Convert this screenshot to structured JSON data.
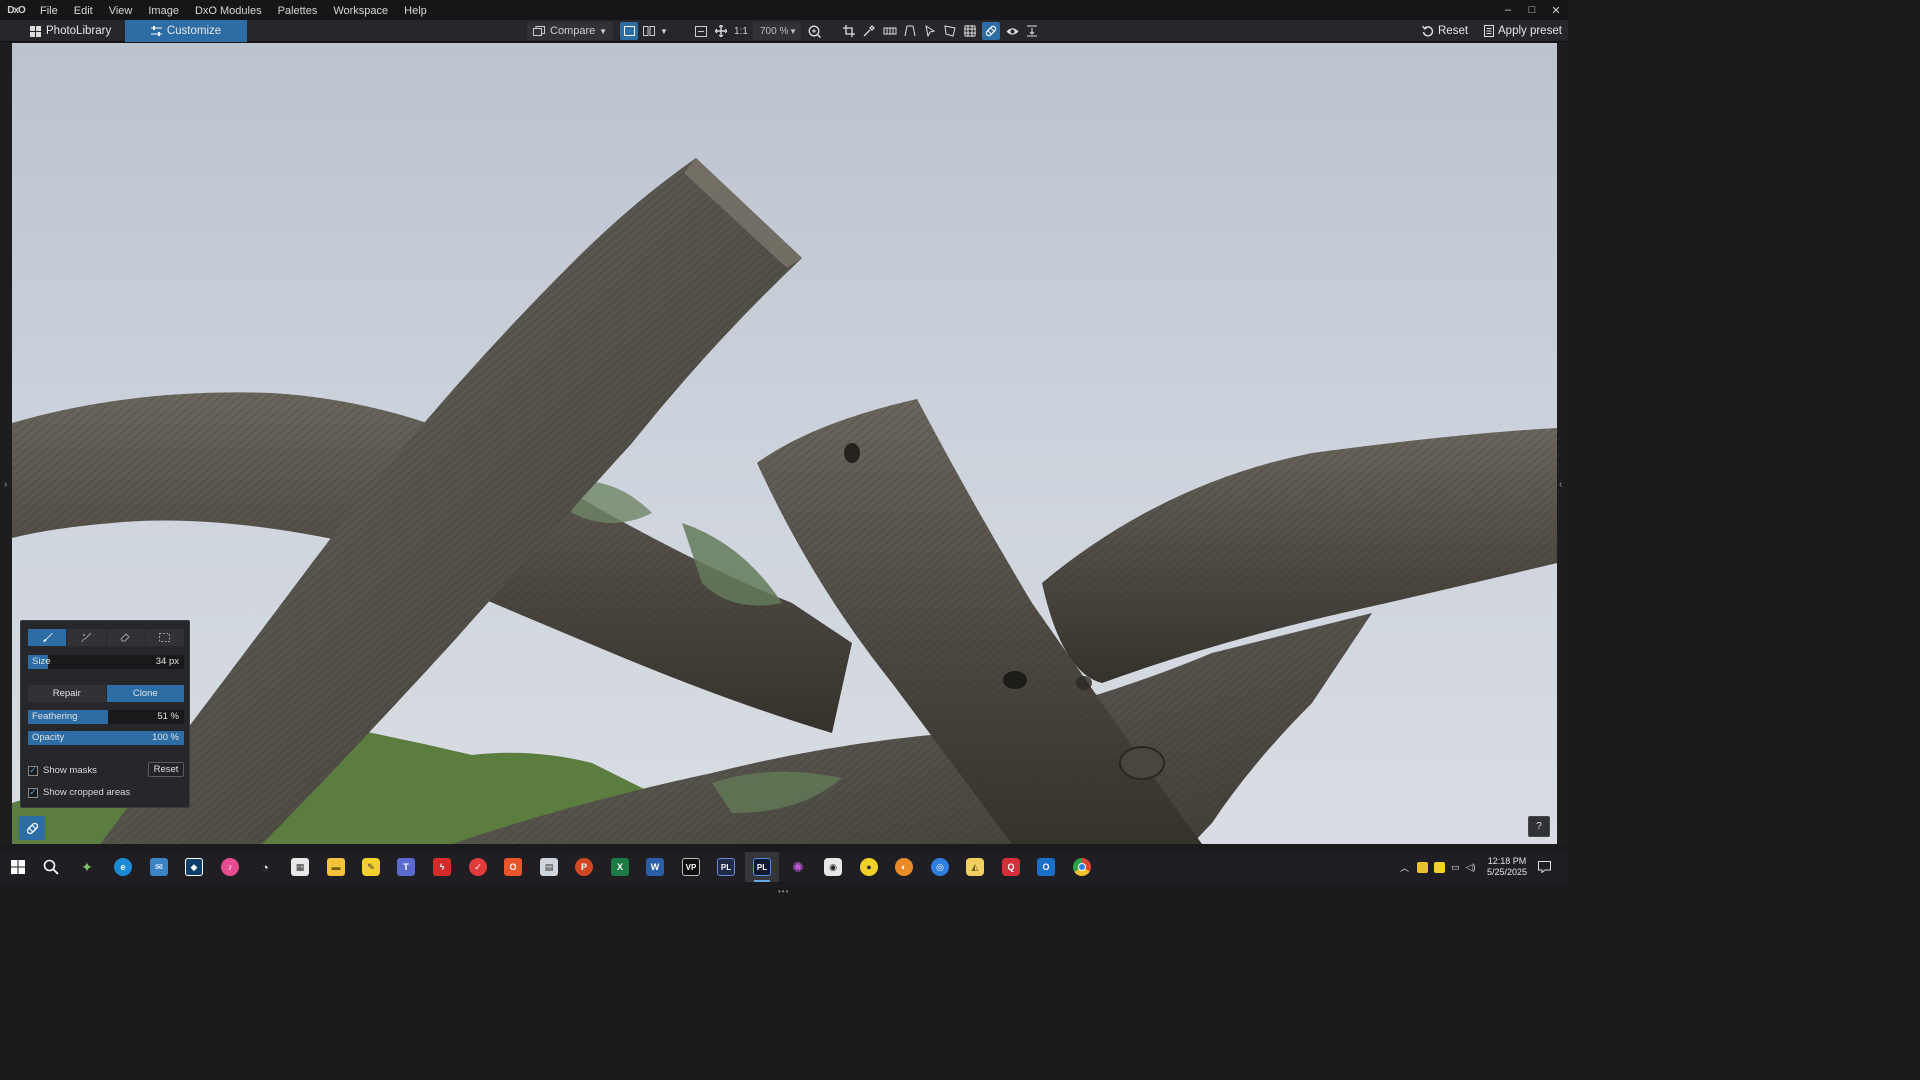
{
  "app": {
    "logo_text": "DxO"
  },
  "menu": [
    "File",
    "Edit",
    "View",
    "Image",
    "DxO Modules",
    "Palettes",
    "Workspace",
    "Help"
  ],
  "window_controls": {
    "minimize": "–",
    "maximize": "□",
    "close": "✕"
  },
  "tabs": {
    "library": "PhotoLibrary",
    "customize": "Customize",
    "active": "Customize"
  },
  "toolbar": {
    "compare_label": "Compare",
    "one_to_one": "1:1",
    "zoom_value": "700 %",
    "reset_label": "Reset",
    "apply_preset_label": "Apply preset",
    "active_tool": "repair-tool"
  },
  "repair_panel": {
    "modes": [
      "brush",
      "auto-brush",
      "eraser",
      "selection"
    ],
    "active_mode": "brush",
    "size": {
      "label": "Size",
      "value": "34 px",
      "fraction": 0.13
    },
    "repair_label": "Repair",
    "clone_label": "Clone",
    "active_type": "Clone",
    "feathering": {
      "label": "Feathering",
      "value": "51 %",
      "fraction": 0.51
    },
    "opacity": {
      "label": "Opacity",
      "value": "100 %",
      "fraction": 1.0
    },
    "show_masks": {
      "label": "Show masks",
      "checked": true
    },
    "show_cropped": {
      "label": "Show cropped areas",
      "checked": true
    },
    "reset_label": "Reset"
  },
  "help_label": "?",
  "taskbar": {
    "apps": [
      "start",
      "search",
      "copilot",
      "edge",
      "mail",
      "store",
      "itunes",
      "speedtest",
      "ms-store",
      "explorer",
      "paint",
      "teams",
      "flashget",
      "todo",
      "office",
      "onenote",
      "powerpoint",
      "excel",
      "word",
      "vp",
      "pl-tool",
      "dxo-photolab",
      "mixer",
      "settings",
      "lemon",
      "firefox-like",
      "maps",
      "photos",
      "unknown-red",
      "outlook",
      "chrome"
    ],
    "clock_time": "12:18 PM",
    "clock_date": "5/25/2025"
  },
  "colors": {
    "accent": "#2c6da6",
    "bg": "#1b1b1d",
    "toolbar": "#26272a"
  }
}
